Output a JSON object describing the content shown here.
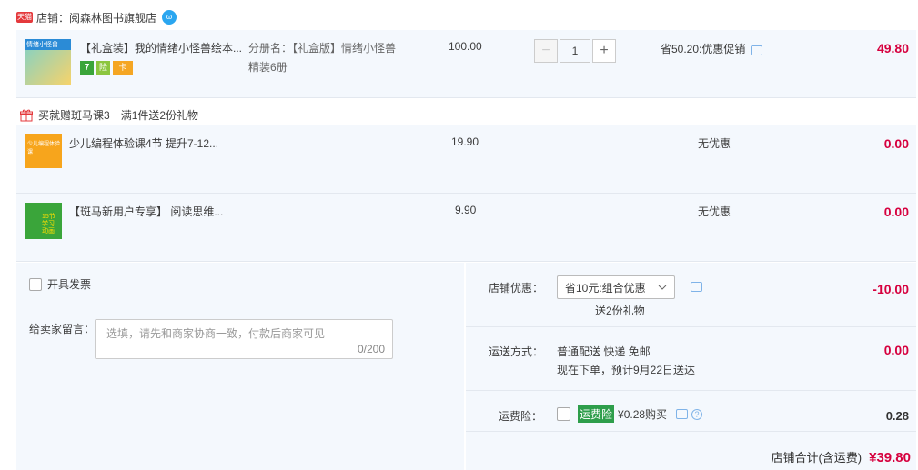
{
  "shop": {
    "badge": "天猫",
    "name": "店铺：阅森林图书旗舰店",
    "wangwang": "ω"
  },
  "main_item": {
    "thumb_text": "情绪小怪兽",
    "title": "【礼盒装】我的情绪小怪兽绘本...",
    "sku_line1": "分册名：【礼盒版】情绪小怪兽",
    "sku_line2": "精装6册",
    "unit_price": "100.00",
    "qty": "1",
    "minus": "−",
    "plus": "+",
    "promo": "省50.20:优惠促销",
    "subtotal": "49.80",
    "badges": [
      "7",
      "险",
      "卡"
    ]
  },
  "gift": {
    "title": "买就赠斑马课3",
    "note": "满1件送2份礼物",
    "items": [
      {
        "title": "少儿编程体验课4节 提升7-12...",
        "price": "19.90",
        "promo": "无优惠",
        "subtotal": "0.00",
        "thumb": "少儿编程体验课"
      },
      {
        "title": "【斑马新用户专享】 阅读思维...",
        "price": "9.90",
        "promo": "无优惠",
        "subtotal": "0.00",
        "thumb": "15节 学习 动画"
      }
    ]
  },
  "invoice": {
    "label": "开具发票"
  },
  "message": {
    "label": "给卖家留言：",
    "placeholder": "选填，请先和商家协商一致，付款后商家可见",
    "counter": "0/200"
  },
  "discount": {
    "label": "店铺优惠：",
    "selected": "省10元:组合优惠",
    "sub": "送2份礼物",
    "amount": "-10.00"
  },
  "shipping": {
    "label": "运送方式：",
    "line1": "普通配送 快递 免邮",
    "line2": "现在下单，预计9月22日送达",
    "amount": "0.00"
  },
  "insurance": {
    "label": "运费险：",
    "tag": "运费险",
    "text": "¥0.28购买",
    "amount": "0.28"
  },
  "total": {
    "label": "店铺合计(含运费)",
    "amount": "¥39.80"
  }
}
